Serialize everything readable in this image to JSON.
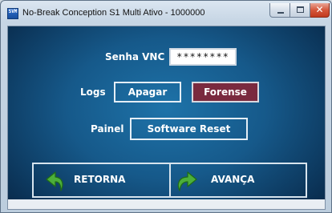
{
  "window": {
    "title": "No-Break Conception S1 Multi Ativo - 1000000",
    "icon_text": "SVM"
  },
  "form": {
    "password_label": "Senha VNC",
    "password_value": "********",
    "logs_label": "Logs",
    "apagar_button": "Apagar",
    "forense_button": "Forense",
    "painel_label": "Painel",
    "reset_button": "Software Reset"
  },
  "nav": {
    "back_label": "RETORNA",
    "forward_label": "AVANÇA"
  },
  "colors": {
    "background_center": "#1e73a9",
    "background_edge": "#082643",
    "forense_bg": "#7a2a3f",
    "arrow_green": "#4caf3a"
  },
  "icons": {
    "back": "curved-arrow-left-icon",
    "forward": "curved-arrow-right-icon"
  }
}
